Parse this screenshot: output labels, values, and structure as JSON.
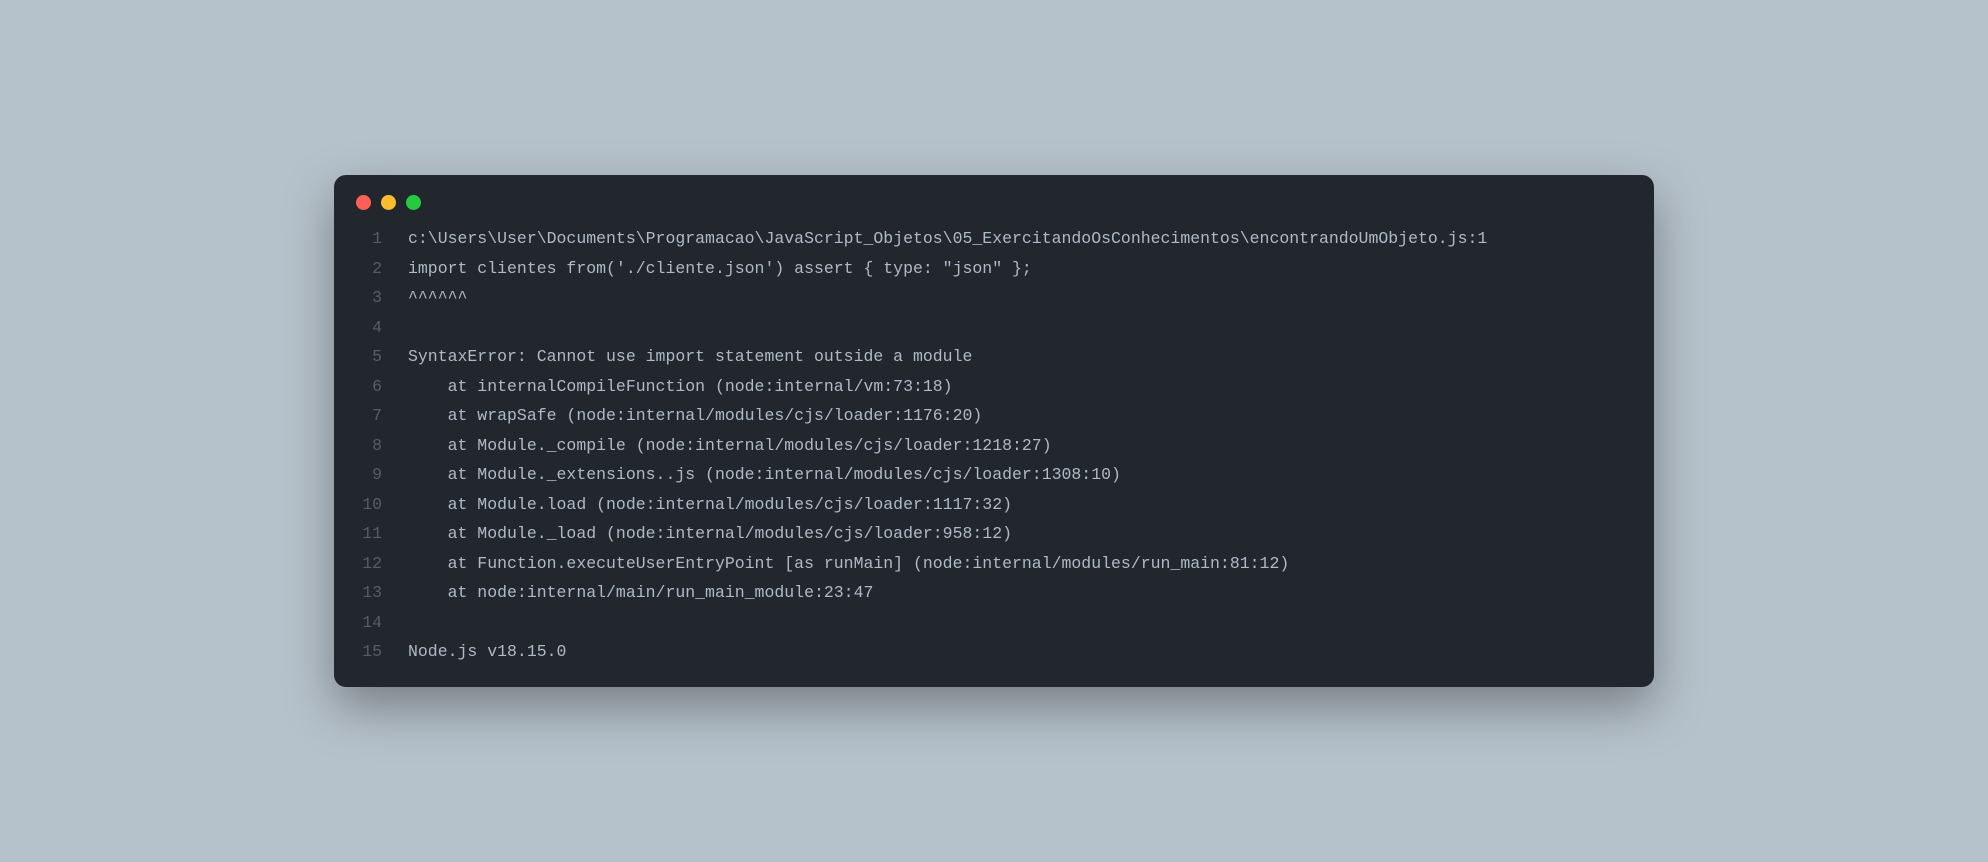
{
  "lines": [
    "c:\\Users\\User\\Documents\\Programacao\\JavaScript_Objetos\\05_ExercitandoOsConhecimentos\\encontrandoUmObjeto.js:1",
    "import clientes from('./cliente.json') assert { type: \"json\" };",
    "^^^^^^",
    "",
    "SyntaxError: Cannot use import statement outside a module",
    "    at internalCompileFunction (node:internal/vm:73:18)",
    "    at wrapSafe (node:internal/modules/cjs/loader:1176:20)",
    "    at Module._compile (node:internal/modules/cjs/loader:1218:27)",
    "    at Module._extensions..js (node:internal/modules/cjs/loader:1308:10)",
    "    at Module.load (node:internal/modules/cjs/loader:1117:32)",
    "    at Module._load (node:internal/modules/cjs/loader:958:12)",
    "    at Function.executeUserEntryPoint [as runMain] (node:internal/modules/run_main:81:12)",
    "    at node:internal/main/run_main_module:23:47",
    "",
    "Node.js v18.15.0"
  ]
}
